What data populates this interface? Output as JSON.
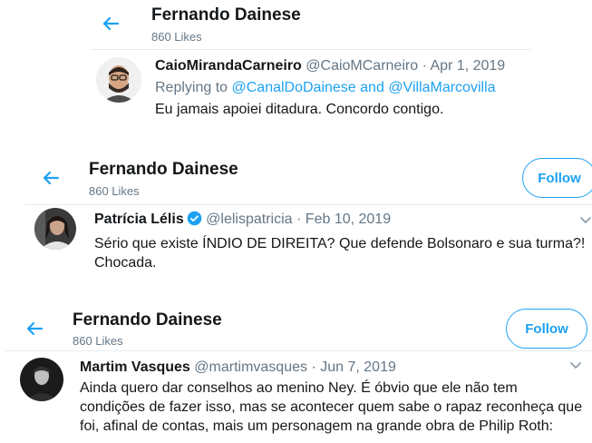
{
  "panels": [
    {
      "header": {
        "title": "Fernando Dainese",
        "likes": "860 Likes"
      },
      "tweet": {
        "display_name": "CaioMirandaCarneiro",
        "handle": "@CaioMCarneiro",
        "sep": "·",
        "date": "Apr 1, 2019",
        "replying_prefix": "Replying to",
        "reply_user_1": "@CanalDoDainese",
        "reply_and": "and",
        "reply_user_2": "@VillaMarcovilla",
        "text": "Eu jamais apoiei ditadura. Concordo contigo."
      }
    },
    {
      "header": {
        "title": "Fernando Dainese",
        "likes": "860 Likes",
        "follow_label": "Follow"
      },
      "tweet": {
        "display_name": "Patrícia Lélis",
        "handle": "@lelispatricia",
        "sep": "·",
        "date": "Feb 10, 2019",
        "text_line1": "Sério que existe ÍNDIO DE DIREITA? Que defende Bolsonaro e sua turma?!",
        "text_line2": "Chocada."
      }
    },
    {
      "header": {
        "title": "Fernando Dainese",
        "likes": "860 Likes",
        "follow_label": "Follow"
      },
      "tweet": {
        "display_name": "Martim Vasques",
        "handle": "@martimvasques",
        "sep": "·",
        "date": "Jun 7, 2019",
        "text_line1": "Ainda quero dar conselhos ao menino Ney. É óbvio que ele não tem",
        "text_line2": "condições de fazer isso, mas se acontecer quem sabe o rapaz reconheça que",
        "text_line3": "foi, afinal de contas, mais um personagem na grande obra de Philip Roth:"
      }
    }
  ],
  "colors": {
    "accent": "#1da1f2",
    "muted": "#657786",
    "text": "#14171a",
    "border": "#e6ecf0"
  },
  "icons": [
    "back-arrow-icon",
    "verified-badge-icon",
    "chevron-down-icon"
  ]
}
